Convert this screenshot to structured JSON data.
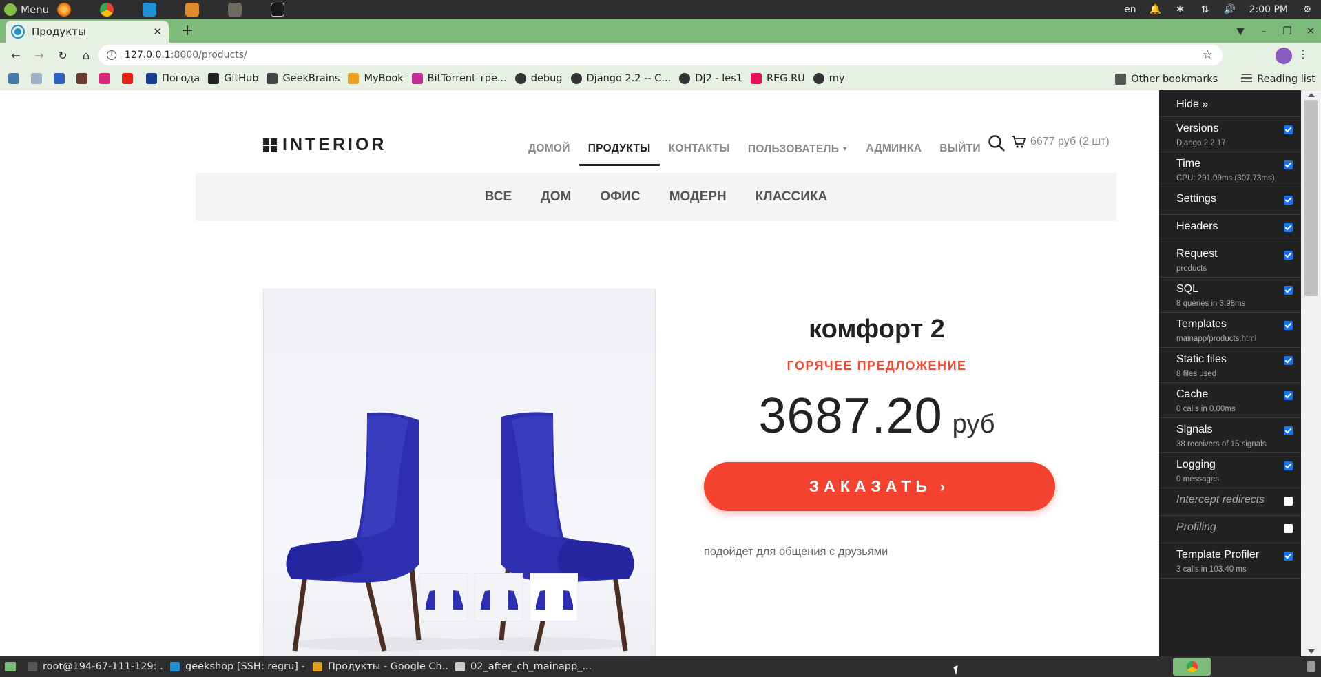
{
  "os_panel": {
    "menu_label": "Menu",
    "apps": [
      "firefox-icon",
      "chrome-icon",
      "vscode-icon",
      "sublime-icon",
      "gimp-icon",
      "terminal-icon"
    ],
    "keyboard_layout": "en",
    "clock": "2:00 PM"
  },
  "browser": {
    "tab_title": "Продукты",
    "url_host": "127.0.0.1",
    "url_path": ":8000/products/",
    "bookmarks": [
      {
        "label": "",
        "icon": "vk-icon",
        "color": "#4a76a8"
      },
      {
        "label": "",
        "icon": "bookmark-icon-2",
        "color": "#a0b0c8"
      },
      {
        "label": "",
        "icon": "bookmark-icon-3",
        "color": "#3060c0"
      },
      {
        "label": "",
        "icon": "bookmark-icon-4",
        "color": "#6a3a30"
      },
      {
        "label": "",
        "icon": "instagram-icon",
        "color": "#d6297a"
      },
      {
        "label": "",
        "icon": "youtube-icon",
        "color": "#e62117"
      },
      {
        "label": "Погода",
        "icon": "weather-icon",
        "color": "#1a3d8f"
      },
      {
        "label": "GitHub",
        "icon": "github-icon",
        "color": "#222222"
      },
      {
        "label": "GeekBrains",
        "icon": "geekbrains-icon",
        "color": "#444444"
      },
      {
        "label": "MyBook",
        "icon": "mybook-icon",
        "color": "#f0a020"
      },
      {
        "label": "BitTorrent тре...",
        "icon": "bittorrent-icon",
        "color": "#c03090"
      },
      {
        "label": "debug",
        "icon": "globe-icon",
        "color": "#333333"
      },
      {
        "label": "Django 2.2 -- C...",
        "icon": "globe-icon",
        "color": "#333333"
      },
      {
        "label": "DJ2 - les1",
        "icon": "globe-icon",
        "color": "#333333"
      },
      {
        "label": "REG.RU",
        "icon": "regru-icon",
        "color": "#e8125c"
      },
      {
        "label": "my",
        "icon": "globe-icon",
        "color": "#333333"
      }
    ],
    "other_bookmarks": "Other bookmarks",
    "reading_list": "Reading list"
  },
  "site": {
    "logo": "INTERIOR",
    "nav": [
      "ДОМОЙ",
      "ПРОДУКТЫ",
      "КОНТАКТЫ",
      "ПОЛЬЗОВАТЕЛЬ",
      "АДМИНКА",
      "ВЫЙТИ"
    ],
    "active_nav": "ПРОДУКТЫ",
    "cart": "6677 руб (2 шт)",
    "categories": [
      "ВСЕ",
      "ДОМ",
      "ОФИС",
      "МОДЕРН",
      "КЛАССИКА"
    ]
  },
  "product": {
    "title": "комфорт 2",
    "badge": "ГОРЯЧЕЕ ПРЕДЛОЖЕНИЕ",
    "price": "3687.20",
    "currency": "руб",
    "order_button": "ЗАКАЗАТЬ",
    "description": "подойдет для общения с друзьями",
    "chair_color": "#2e2fae"
  },
  "debug_toolbar": {
    "hide": "Hide »",
    "panels": [
      {
        "title": "Versions",
        "sub": "Django 2.2.17",
        "checked": true
      },
      {
        "title": "Time",
        "sub": "CPU: 291.09ms (307.73ms)",
        "checked": true
      },
      {
        "title": "Settings",
        "sub": "",
        "checked": true
      },
      {
        "title": "Headers",
        "sub": "",
        "checked": true
      },
      {
        "title": "Request",
        "sub": "products",
        "checked": true
      },
      {
        "title": "SQL",
        "sub": "8 queries in 3.98ms",
        "checked": true
      },
      {
        "title": "Templates",
        "sub": "mainapp/products.html",
        "checked": true
      },
      {
        "title": "Static files",
        "sub": "8 files used",
        "checked": true
      },
      {
        "title": "Cache",
        "sub": "0 calls in 0.00ms",
        "checked": true
      },
      {
        "title": "Signals",
        "sub": "38 receivers of 15 signals",
        "checked": true
      },
      {
        "title": "Logging",
        "sub": "0 messages",
        "checked": true
      },
      {
        "title": "Intercept redirects",
        "sub": "",
        "checked": false
      },
      {
        "title": "Profiling",
        "sub": "",
        "checked": false
      },
      {
        "title": "Template Profiler",
        "sub": "3 calls in 103.40 ms",
        "checked": true
      }
    ]
  },
  "taskbar": {
    "items": [
      {
        "label": "root@194-67-111-129: ...",
        "icon": "terminal-icon",
        "color": "#555555"
      },
      {
        "label": "geekshop [SSH: regru] -...",
        "icon": "vscode-icon",
        "color": "#1f8fd6"
      },
      {
        "label": "Продукты - Google Ch...",
        "icon": "chrome-icon",
        "color": "#e0a020"
      },
      {
        "label": "02_after_ch_mainapp_...",
        "icon": "image-viewer-icon",
        "color": "#cccccc"
      }
    ]
  }
}
